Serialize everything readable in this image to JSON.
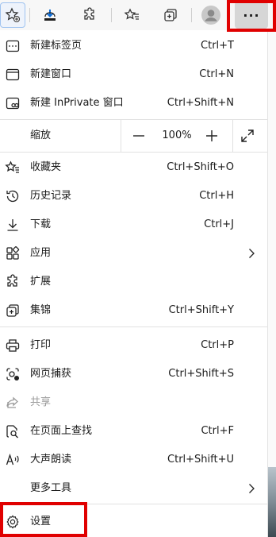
{
  "toolbar": {
    "buttons": [
      "add-favorite-icon",
      "download-icon",
      "extensions-icon",
      "favorites-icon",
      "collections-icon",
      "profile-avatar",
      "more-icon"
    ],
    "more_label": "···"
  },
  "menu": {
    "items_top": [
      {
        "label": "新建标签页",
        "shortcut": "Ctrl+T"
      },
      {
        "label": "新建窗口",
        "shortcut": "Ctrl+N"
      },
      {
        "label": "新建 InPrivate 窗口",
        "shortcut": "Ctrl+Shift+N"
      }
    ],
    "zoom": {
      "label": "缩放",
      "minus": "—",
      "value": "100%",
      "plus": "+"
    },
    "items_mid": [
      {
        "label": "收藏夹",
        "shortcut": "Ctrl+Shift+O"
      },
      {
        "label": "历史记录",
        "shortcut": "Ctrl+H"
      },
      {
        "label": "下载",
        "shortcut": "Ctrl+J"
      },
      {
        "label": "应用",
        "shortcut": ""
      },
      {
        "label": "扩展",
        "shortcut": ""
      },
      {
        "label": "集锦",
        "shortcut": "Ctrl+Shift+Y"
      }
    ],
    "items_low": [
      {
        "label": "打印",
        "shortcut": "Ctrl+P"
      },
      {
        "label": "网页捕获",
        "shortcut": "Ctrl+Shift+S"
      },
      {
        "label": "共享",
        "shortcut": ""
      },
      {
        "label": "在页面上查找",
        "shortcut": "Ctrl+F"
      },
      {
        "label": "大声朗读",
        "shortcut": "Ctrl+Shift+U"
      },
      {
        "label": "更多工具",
        "shortcut": ""
      }
    ],
    "settings": {
      "label": "设置"
    }
  },
  "colors": {
    "highlight": "#e00000",
    "accent": "#0078d4"
  }
}
